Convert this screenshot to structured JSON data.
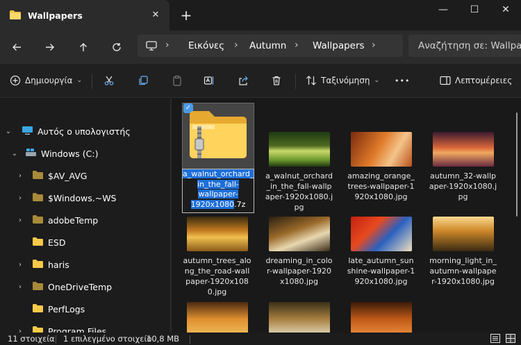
{
  "window": {
    "tab_title": "Wallpapers",
    "new_tab": "+",
    "min": "—",
    "max": "☐",
    "close": "✕",
    "tab_close": "✕"
  },
  "address": {
    "crumbs": [
      "Εικόνες",
      "Autumn",
      "Wallpapers"
    ],
    "search_placeholder": "Αναζήτηση σε: Wallpapers"
  },
  "toolbar": {
    "new_label": "Δημιουργία",
    "sort_label": "Ταξινόμηση",
    "more": "•••",
    "details_label": "Λεπτομέρειες"
  },
  "sidebar": {
    "items": [
      {
        "label": "Αυτός ο υπολογιστής",
        "icon": "pc-icon",
        "expanded": true
      },
      {
        "label": "Windows (C:)",
        "icon": "drive-icon",
        "expanded": true
      },
      {
        "label": "$AV_AVG",
        "icon": "folder-dim-icon"
      },
      {
        "label": "$Windows.~WS",
        "icon": "folder-dim-icon"
      },
      {
        "label": "adobeTemp",
        "icon": "folder-dim-icon"
      },
      {
        "label": "ESD",
        "icon": "folder-icon"
      },
      {
        "label": "haris",
        "icon": "folder-icon"
      },
      {
        "label": "OneDriveTemp",
        "icon": "folder-dim-icon"
      },
      {
        "label": "PerfLogs",
        "icon": "folder-icon"
      },
      {
        "label": "Program Files",
        "icon": "folder-icon"
      }
    ]
  },
  "files": {
    "selected_name_lines": [
      "a_walnut_orchard_",
      "in_the_fall-",
      "wallpaper-",
      "1920x1080"
    ],
    "selected_ext": ".7z",
    "items": [
      {
        "name": "a_walnut_orchard_in_the_fall-wallpaper-1920x1080.7z",
        "icon": "zip-folder-icon"
      },
      {
        "name": "a_walnut_orchard_in_the_fall-wallpaper-1920x1080.jpg",
        "colors": [
          "#1f3a12",
          "#6f9a2f",
          "#c9d86a"
        ]
      },
      {
        "name": "amazing_orange_trees-wallpaper-1920x1080.jpg",
        "colors": [
          "#7a2a0c",
          "#e07a2a",
          "#f4c48a"
        ]
      },
      {
        "name": "autumn_32-wallpaper-1920x1080.jpg",
        "colors": [
          "#3a1a30",
          "#d9663a",
          "#f0a860"
        ]
      },
      {
        "name": "autumn_trees_along_the_road-wallpaper-1920x1080.jpg",
        "colors": [
          "#3a2a10",
          "#c27a1e",
          "#f0c050"
        ]
      },
      {
        "name": "dreaming_in_color-wallpaper-1920x1080.jpg",
        "colors": [
          "#2a1e10",
          "#9a6a2a",
          "#e8d8b0"
        ]
      },
      {
        "name": "late_autumn_sunshine-wallpaper-1920x1080.jpg",
        "colors": [
          "#c22010",
          "#2a60c0",
          "#f0e0c0"
        ]
      },
      {
        "name": "morning_light_in_autumn-wallpaper-1920x1080.jpg",
        "colors": [
          "#3a2a12",
          "#d08a2a",
          "#f8d890"
        ]
      },
      {
        "name": "",
        "colors": [
          "#4a2a10",
          "#e09030",
          "#f0c060"
        ]
      },
      {
        "name": "",
        "colors": [
          "#3a3018",
          "#a88040",
          "#e8e0c8"
        ]
      },
      {
        "name": "",
        "colors": [
          "#3a1a08",
          "#c05a18",
          "#f09040"
        ]
      }
    ]
  },
  "status": {
    "count": "11 στοιχεία",
    "selected": "1 επιλεγμένο στοιχείο",
    "size": "10,8 MB"
  }
}
